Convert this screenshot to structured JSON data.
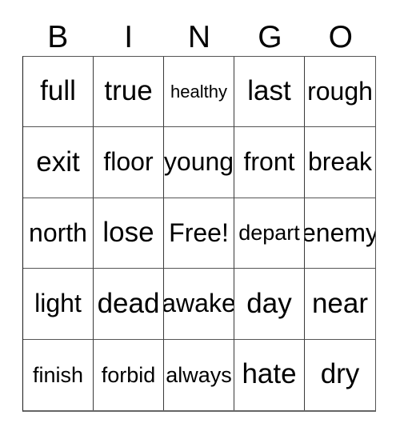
{
  "card": {
    "title": "BINGO",
    "header_letters": [
      "B",
      "I",
      "N",
      "G",
      "O"
    ],
    "background_color": "#ffffff",
    "text_color": "#000000",
    "border_color": "#3a3a3a",
    "rows": 5,
    "columns": 5,
    "free_space_label": "Free!",
    "cells": [
      {
        "text": "full",
        "row": 1,
        "col": 1
      },
      {
        "text": "true",
        "row": 1,
        "col": 2
      },
      {
        "text": "healthy",
        "row": 1,
        "col": 3
      },
      {
        "text": "last",
        "row": 1,
        "col": 4
      },
      {
        "text": "rough",
        "row": 1,
        "col": 5
      },
      {
        "text": "exit",
        "row": 2,
        "col": 1
      },
      {
        "text": "floor",
        "row": 2,
        "col": 2
      },
      {
        "text": "young",
        "row": 2,
        "col": 3
      },
      {
        "text": "front",
        "row": 2,
        "col": 4
      },
      {
        "text": "break",
        "row": 2,
        "col": 5
      },
      {
        "text": "north",
        "row": 3,
        "col": 1
      },
      {
        "text": "lose",
        "row": 3,
        "col": 2
      },
      {
        "text": "Free!",
        "row": 3,
        "col": 3
      },
      {
        "text": "depart",
        "row": 3,
        "col": 4
      },
      {
        "text": "enemy",
        "row": 3,
        "col": 5
      },
      {
        "text": "light",
        "row": 4,
        "col": 1
      },
      {
        "text": "dead",
        "row": 4,
        "col": 2
      },
      {
        "text": "awake",
        "row": 4,
        "col": 3
      },
      {
        "text": "day",
        "row": 4,
        "col": 4
      },
      {
        "text": "near",
        "row": 4,
        "col": 5
      },
      {
        "text": "finish",
        "row": 5,
        "col": 1
      },
      {
        "text": "forbid",
        "row": 5,
        "col": 2
      },
      {
        "text": "always",
        "row": 5,
        "col": 3
      },
      {
        "text": "hate",
        "row": 5,
        "col": 4
      },
      {
        "text": "dry",
        "row": 5,
        "col": 5
      }
    ]
  }
}
